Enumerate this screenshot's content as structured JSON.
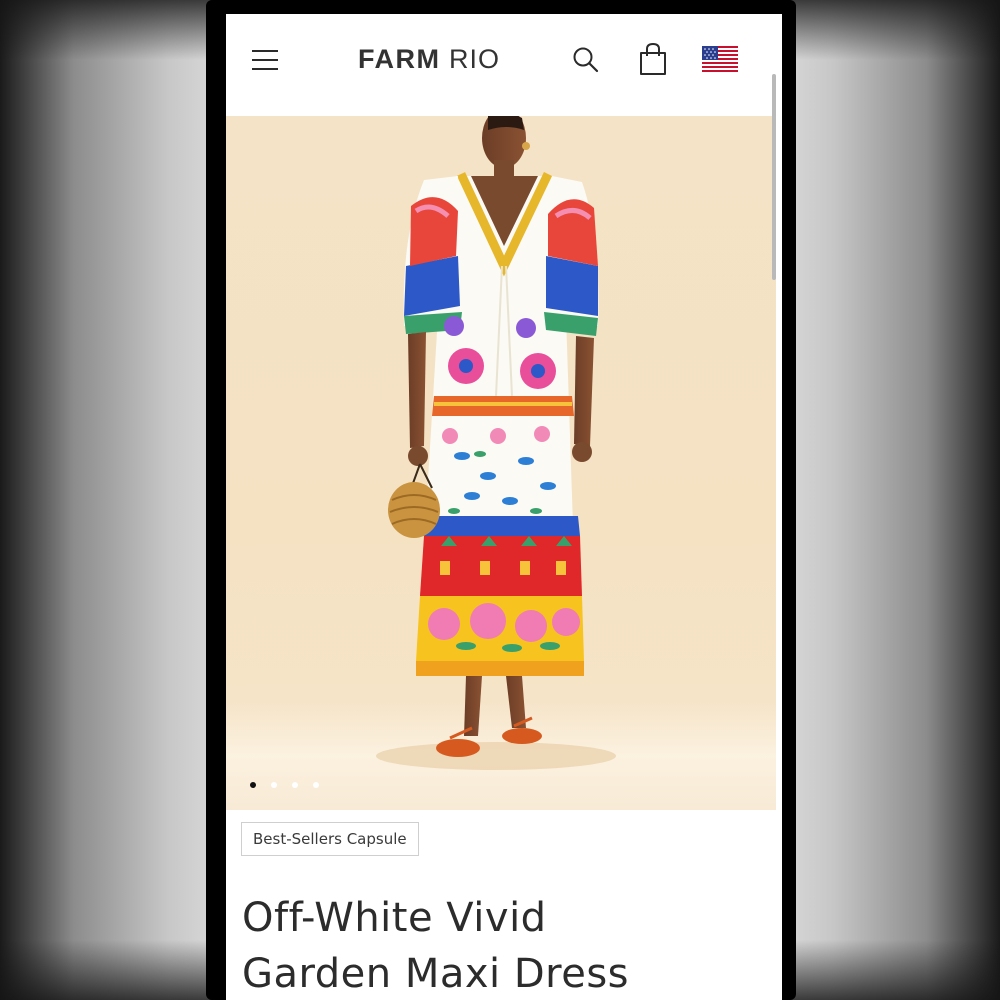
{
  "header": {
    "logo_primary": "FARM",
    "logo_secondary": "RIO",
    "menu_icon": "hamburger-menu-icon",
    "search_icon": "search-icon",
    "bag_icon": "shopping-bag-icon",
    "flag_icon": "us-flag-icon"
  },
  "gallery": {
    "image_count": 4,
    "active_index": 1
  },
  "product": {
    "badge": "Best-Sellers Capsule",
    "title_line1": "Off-White Vivid",
    "title_line2": "Garden Maxi Dress"
  },
  "colors": {
    "hero_background": "#f4e3c6",
    "text_primary": "#2c2c2c",
    "frame": "#000000"
  }
}
